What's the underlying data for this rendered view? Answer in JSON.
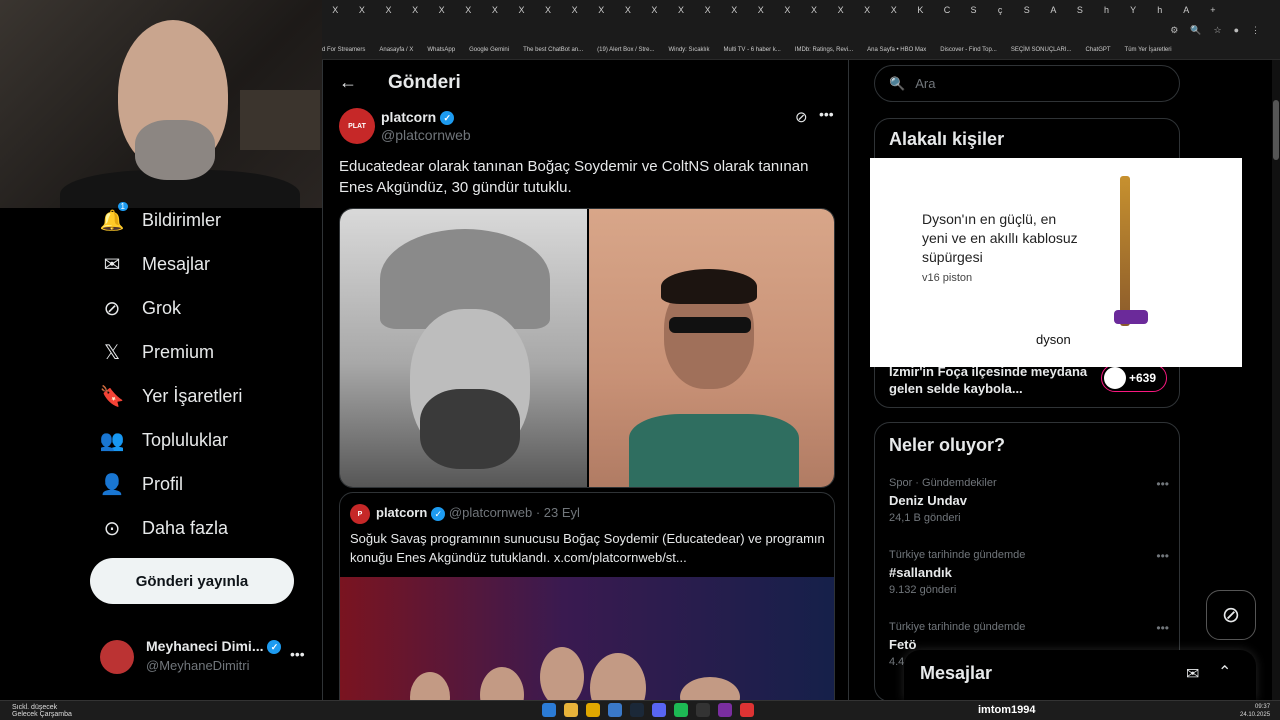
{
  "browser": {
    "tabs": [
      "X",
      "X",
      "X",
      "X",
      "X",
      "X",
      "X",
      "X",
      "X",
      "X",
      "X",
      "X",
      "X",
      "X",
      "X",
      "X",
      "X",
      "X",
      "X",
      "X",
      "X",
      "X",
      "K",
      "C",
      "S",
      "ç",
      "S",
      "A",
      "S",
      "h",
      "Y",
      "h",
      "A"
    ],
    "new_tab": "+",
    "bookmarks": [
      "d For Streamers",
      "Anasayfa / X",
      "WhatsApp",
      "Google Gemini",
      "The best ChatBot an...",
      "(19) Alert Box / Stre...",
      "Windy: Sıcaklık",
      "Multi TV - 6 haber k...",
      "IMDb: Ratings, Revi...",
      "Ana Sayfa • HBO Max",
      "Discover - Find Top...",
      "SEÇİM SONUÇLARI...",
      "ChatGPT",
      "Tüm Yer İşaretleri"
    ]
  },
  "sidebar": {
    "items": [
      {
        "label": "Bildirimler",
        "icon": "bell-icon",
        "badge": "1"
      },
      {
        "label": "Mesajlar",
        "icon": "mail-icon"
      },
      {
        "label": "Grok",
        "icon": "grok-icon"
      },
      {
        "label": "Premium",
        "icon": "x-logo-icon"
      },
      {
        "label": "Yer İşaretleri",
        "icon": "bookmark-icon"
      },
      {
        "label": "Topluluklar",
        "icon": "people-icon"
      },
      {
        "label": "Profil",
        "icon": "person-icon"
      },
      {
        "label": "Daha fazla",
        "icon": "more-circle-icon"
      }
    ],
    "post_button": "Gönderi yayınla",
    "account": {
      "name": "Meyhaneci Dimi...",
      "handle": "@MeyhaneDimitri"
    }
  },
  "main": {
    "title": "Gönderi",
    "tweet": {
      "name": "platcorn",
      "handle": "@platcornweb",
      "text": "Educatedear olarak tanınan Boğaç Soydemir ve ColtNS olarak tanınan Enes Akgündüz, 30 gündür tutuklu."
    },
    "quote": {
      "name": "platcorn",
      "handle": "@platcornweb",
      "date": "· 23 Eyl",
      "text": "Soğuk Savaş programının sunucusu Boğaç Soydemir (Educatedear) ve programın konuğu Enes Akgündüz tutuklandı.  x.com/platcornweb/st..."
    }
  },
  "right": {
    "search_placeholder": "Ara",
    "related_title": "Alakalı kişiler",
    "ad": {
      "text": "Dyson'ın en güçlü, en yeni ve en akıllı kablosuz süpürgesi",
      "model": "v16 piston",
      "brand": "dyson"
    },
    "story": {
      "text": "İzmir'in Foça ilçesinde meydana gelen selde kaybola...",
      "count": "+639"
    },
    "trends_title": "Neler oluyor?",
    "trends": [
      {
        "context": "Spor · Gündemdekiler",
        "topic": "Deniz Undav",
        "posts": "24,1 B gönderi"
      },
      {
        "context": "Türkiye tarihinde gündemde",
        "topic": "#sallandık",
        "posts": "9.132 gönderi"
      },
      {
        "context": "Türkiye tarihinde gündemde",
        "topic": "Fetö",
        "posts": "4.4"
      }
    ],
    "messages_title": "Mesajlar"
  },
  "taskbar": {
    "weather_line1": "Sıckl. düşecek",
    "weather_line2": "Gelecek Çarşamba",
    "user": "imtom1994",
    "time": "09:37",
    "date": "24.10.2025"
  }
}
